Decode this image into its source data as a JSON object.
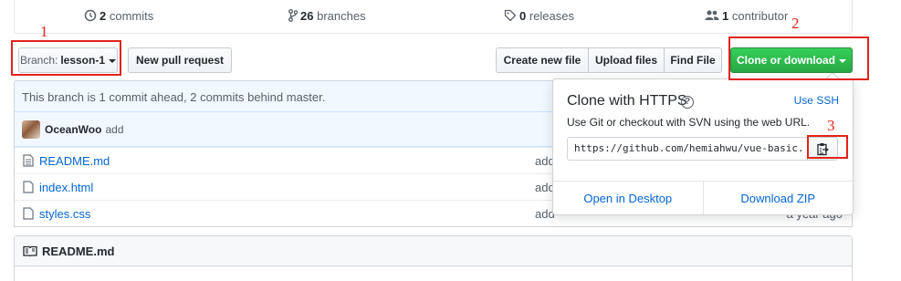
{
  "stats": {
    "commits_count": "2",
    "commits_label": "commits",
    "branches_count": "26",
    "branches_label": "branches",
    "releases_count": "0",
    "releases_label": "releases",
    "contributors_count": "1",
    "contributors_label": "contributor"
  },
  "toolbar": {
    "branch_prefix": "Branch:",
    "branch_name": "lesson-1",
    "new_pull_request": "New pull request",
    "create_new_file": "Create new file",
    "upload_files": "Upload files",
    "find_file": "Find File",
    "clone_or_download": "Clone or download"
  },
  "branch_info": "This branch is 1 commit ahead, 2 commits behind master.",
  "latest_commit": {
    "author": "OceanWoo",
    "message": "add"
  },
  "files": [
    {
      "name": "README.md",
      "message": "add",
      "age": ""
    },
    {
      "name": "index.html",
      "message": "add",
      "age": ""
    },
    {
      "name": "styles.css",
      "message": "add",
      "age": "a year ago"
    }
  ],
  "readme": {
    "title": "README.md"
  },
  "clone_panel": {
    "title": "Clone with HTTPS",
    "help_glyph": "?",
    "use_ssh": "Use SSH",
    "description": "Use Git or checkout with SVN using the web URL.",
    "url": "https://github.com/hemiahwu/vue-basic.",
    "open_in_desktop": "Open in Desktop",
    "download_zip": "Download ZIP"
  },
  "annotations": [
    {
      "number": "1"
    },
    {
      "number": "2"
    },
    {
      "number": "3"
    }
  ],
  "colors": {
    "accent_green": "#28a745",
    "link_blue": "#0366d6",
    "annotation_red": "#e2231a"
  }
}
